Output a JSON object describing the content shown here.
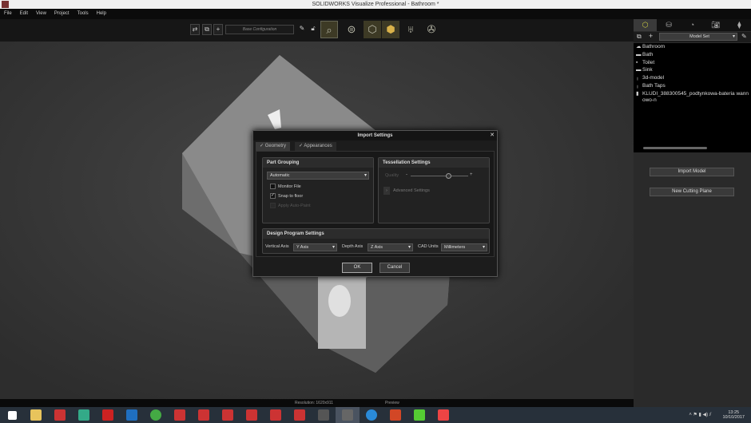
{
  "window": {
    "title": "SOLIDWORKS Visualize Professional - Bathroom *"
  },
  "menu": [
    "File",
    "Edit",
    "View",
    "Project",
    "Tools",
    "Help"
  ],
  "toolbar": {
    "configuration": "Base Configuration"
  },
  "right_panel": {
    "model_set": "Model Set",
    "tree": [
      {
        "icon": "model-icon",
        "label": "Bathroom"
      },
      {
        "icon": "part-icon",
        "label": "Bath"
      },
      {
        "icon": "part-icon",
        "label": "Toilet"
      },
      {
        "icon": "part-icon",
        "label": "Sink"
      },
      {
        "icon": "part-icon",
        "label": "3d-model"
      },
      {
        "icon": "part-icon",
        "label": "Bath Taps"
      },
      {
        "icon": "part-icon",
        "label": "KLUDI_388300545_podtynkowa-bateria wannowo-n"
      }
    ],
    "import_model": "Import Model",
    "new_cutting_plane": "New Cutting Plane"
  },
  "dialog": {
    "title": "Import Settings",
    "tabs": [
      {
        "label": "Geometry",
        "checked": true
      },
      {
        "label": "Appearances",
        "checked": true
      }
    ],
    "part_grouping": {
      "title": "Part Grouping",
      "value": "Automatic",
      "monitor_file": "Monitor File",
      "monitor_checked": false,
      "snap_to_floor": "Snap to floor",
      "snap_checked": true,
      "apply_auto_paint": "Apply Auto-Paint"
    },
    "tessellation": {
      "title": "Tessellation Settings",
      "quality_label": "Quality",
      "quality_minus": "-",
      "quality_plus": "+",
      "quality_value": 0.67,
      "advanced": "Advanced Settings"
    },
    "design": {
      "title": "Design Program Settings",
      "vertical_axis_label": "Vertical Axis",
      "vertical_axis": "Y Axis",
      "depth_axis_label": "Depth Axis",
      "depth_axis": "Z Axis",
      "cad_units_label": "CAD Units",
      "cad_units": "Millimeters"
    },
    "ok": "OK",
    "cancel": "Cancel"
  },
  "status": {
    "resolution": "Resolution: 1620x911",
    "preview": "Preview"
  },
  "clock": {
    "time": "13:25",
    "date": "10/10/2017"
  }
}
